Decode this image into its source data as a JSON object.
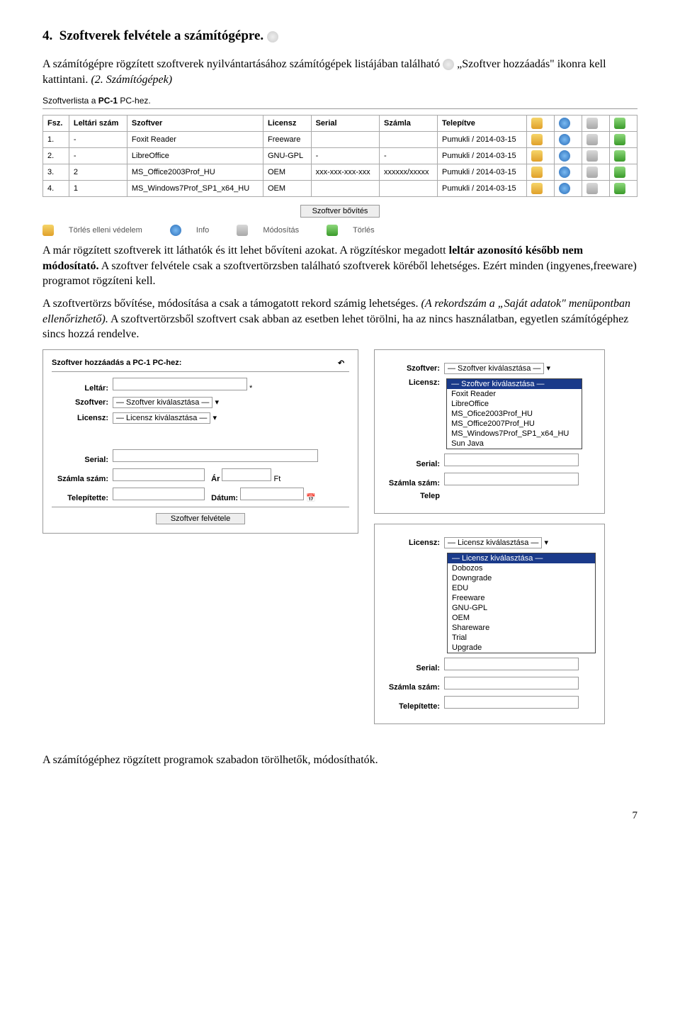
{
  "section": {
    "num": "4.",
    "title": "Szoftverek felvétele a számítógépre."
  },
  "p1_a": "A számítógépre rögzített szoftverek nyilvántartásához  számítógépek listájában található ",
  "p1_b": "„Szoftver hozzáadás\" ikonra kell kattintani. ",
  "p1_c": "(2. Számítógépek)",
  "list_title_a": "Szoftverlista a ",
  "list_title_pc": "PC-1",
  "list_title_b": " PC-hez.",
  "th": {
    "fsz": "Fsz.",
    "leltar": "Leltári szám",
    "szoftver": "Szoftver",
    "licensz": "Licensz",
    "serial": "Serial",
    "szamla": "Számla",
    "telepitve": "Telepítve"
  },
  "rows": [
    {
      "n": "1.",
      "lelt": "-",
      "sw": "Foxit Reader",
      "lic": "Freeware",
      "ser": "",
      "sz": "",
      "tel": "Pumukli / 2014-03-15"
    },
    {
      "n": "2.",
      "lelt": "-",
      "sw": "LibreOffice",
      "lic": "GNU-GPL",
      "ser": "-",
      "sz": "-",
      "tel": "Pumukli / 2014-03-15"
    },
    {
      "n": "3.",
      "lelt": "2",
      "sw": "MS_Office2003Prof_HU",
      "lic": "OEM",
      "ser": "xxx-xxx-xxx-xxx",
      "sz": "xxxxxx/xxxxx",
      "tel": "Pumukli / 2014-03-15"
    },
    {
      "n": "4.",
      "lelt": "1",
      "sw": "MS_Windows7Prof_SP1_x64_HU",
      "lic": "OEM",
      "ser": "",
      "sz": "",
      "tel": "Pumukli / 2014-03-15"
    }
  ],
  "btn_bovites": "Szoftver bővítés",
  "legend": {
    "a": "Törlés elleni védelem",
    "b": "Info",
    "c": "Módosítás",
    "d": "Törlés"
  },
  "p2_a": "A már rögzített szoftverek itt láthatók és itt lehet bővíteni azokat. A rögzítéskor megadott ",
  "p2_b": "leltár azonosító később nem módosítató.",
  "p2_c": " A szoftver felvétele csak a szoftvertörzsben található szoftverek köréből lehetséges. Ezért minden (ingyenes,freeware) programot rögzíteni kell.",
  "p3_a": "A szoftvertörzs bővítése, módosítása a csak a támogatott rekord számig lehetséges. ",
  "p3_b": "(A rekordszám a „Saját adatok\" menüpontban ellenőrizhető).",
  "p3_c": " A szoftvertörzsből  szoftvert csak abban az esetben lehet törölni, ha az nincs használatban,  egyetlen számítógéphez  sincs hozzá rendelve.",
  "form": {
    "title_a": "Szoftver hozzáadás a ",
    "title_pc": "PC-1",
    "title_b": " PC-hez:",
    "leltar": "Leltár:",
    "szoftver": "Szoftver:",
    "szoftver_sel": "— Szoftver kiválasztása —",
    "licensz": "Licensz:",
    "licensz_sel": "— Licensz kiválasztása —",
    "serial": "Serial:",
    "szamla": "Számla szám:",
    "ar_lbl": "Ár",
    "ar_unit": "Ft",
    "telepitette": "Telepítette:",
    "datum": "Dátum:",
    "btn": "Szoftver felvétele"
  },
  "dd_soft": {
    "label": "Szoftver:",
    "sel": "— Szoftver kiválasztása —",
    "hdr": "— Szoftver kiválasztása —",
    "opts": [
      "Foxit Reader",
      "LibreOffice",
      "MS_Ofice2003Prof_HU",
      "MS_Office2007Prof_HU",
      "MS_Windows7Prof_SP1_x64_HU",
      "Sun Java"
    ],
    "licensz": "Licensz:",
    "serial": "Serial:",
    "szamla": "Számla szám:",
    "telep": "Telep"
  },
  "dd_lic": {
    "label": "Licensz:",
    "sel": "— Licensz kiválasztása —",
    "hdr": "— Licensz kiválasztása —",
    "opts": [
      "Dobozos",
      "Downgrade",
      "EDU",
      "Freeware",
      "GNU-GPL",
      "OEM",
      "Shareware",
      "Trial",
      "Upgrade"
    ],
    "serial": "Serial:",
    "szamla": "Számla szám:",
    "telepitette": "Telepítette:"
  },
  "p4": "A számítógéphez rögzített programok szabadon törölhetők, módosíthatók.",
  "pagenum": "7"
}
